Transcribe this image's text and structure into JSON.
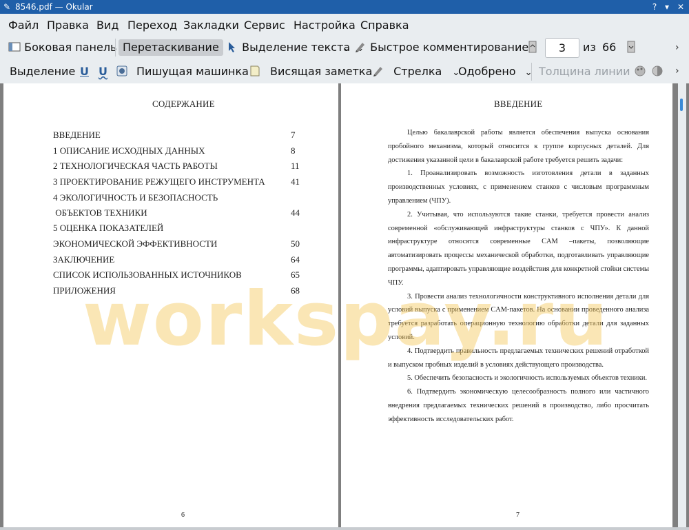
{
  "window": {
    "title": "8546.pdf  — Okular"
  },
  "menu": [
    "Файл",
    "Правка",
    "Вид",
    "Переход",
    "Закладки",
    "Сервис",
    "Настройка",
    "Справка"
  ],
  "toolbar1": {
    "sidebar": "Боковая панель",
    "drag": "Перетаскивание",
    "text_select": "Выделение текста",
    "quick_comment": "Быстрое комментирование",
    "page_current": "3",
    "page_of": "из",
    "page_total": "66"
  },
  "toolbar2": {
    "selection": "Выделение",
    "typewriter": "Пишущая машинка",
    "hanging_note": "Висящая заметка",
    "arrow": "Стрелка",
    "approved": "Одобрено",
    "line_width": "Толщина линии"
  },
  "left_page": {
    "title": "СОДЕРЖАНИЕ",
    "toc": [
      {
        "text": "ВВЕДЕНИЕ",
        "page": "7"
      },
      {
        "text": "1 ОПИСАНИЕ ИСХОДНЫХ ДАННЫХ",
        "page": "8"
      },
      {
        "text": "2 ТЕХНОЛОГИЧЕСКАЯ ЧАСТЬ РАБОТЫ",
        "page": "11"
      },
      {
        "text": "3 ПРОЕКТИРОВАНИЕ РЕЖУЩЕГО ИНСТРУМЕНТА",
        "page": "41"
      },
      {
        "text": "4 ЭКОЛОГИЧНОСТЬ И БЕЗОПАСНОСТЬ",
        "page": ""
      },
      {
        "text": " ОБЪЕКТОВ ТЕХНИКИ",
        "page": "44"
      },
      {
        "text": "5 ОЦЕНКА ПОКАЗАТЕЛЕЙ",
        "page": ""
      },
      {
        "text": "ЭКОНОМИЧЕСКОЙ ЭФФЕКТИВНОСТИ",
        "page": "50"
      },
      {
        "text": "ЗАКЛЮЧЕНИЕ",
        "page": "64"
      },
      {
        "text": "СПИСОК ИСПОЛЬЗОВАННЫХ ИСТОЧНИКОВ",
        "page": "65"
      },
      {
        "text": "ПРИЛОЖЕНИЯ",
        "page": "68"
      }
    ],
    "number": "6"
  },
  "right_page": {
    "title": "ВВЕДЕНИЕ",
    "paragraphs": [
      "Целью бакалаврской работы является обеспечения выпуска основания пробойного механизма, который относится к группе корпусных деталей. Для достижения указанной цели в бакалаврской работе требуется решить задачи:",
      "1. Проанализировать возможность изготовления детали в заданных производственных условиях, с применением станков с числовым программным управлением (ЧПУ).",
      "2. Учитывая, что используются такие станки, требуется провести анализ современной «обслуживающей инфраструктуры станков с ЧПУ». К данной инфраструктуре относятся современные CAM –пакеты, позволяющие автоматизировать процессы механической обработки, подготавливать управляющие программы, адаптировать управляющие воздействия для конкретной стойки системы ЧПУ.",
      "3. Провести анализ технологичности конструктивного исполнения детали для условий выпуска с применением CAM-пакетов.  На основании проведенного анализа требуется разработать операционную технологию обработки детали для заданных условий.",
      "4. Подтвердить правильность предлагаемых технических решений отработкой и выпуском пробных изделий в условиях действующего производства.",
      "5. Обеспечить безопасность и экологичность используемых объектов техники.",
      "6. Подтвердить экономическую целесообразность полного или частичного внедрения предлагаемых технических решений в производство, либо просчитать эффективность исследовательских работ."
    ],
    "number": "7"
  },
  "watermark": "workspay.ru",
  "colors": {
    "titlebar": "#1f5fa9",
    "scroll_thumb": "#3a8ad6"
  }
}
